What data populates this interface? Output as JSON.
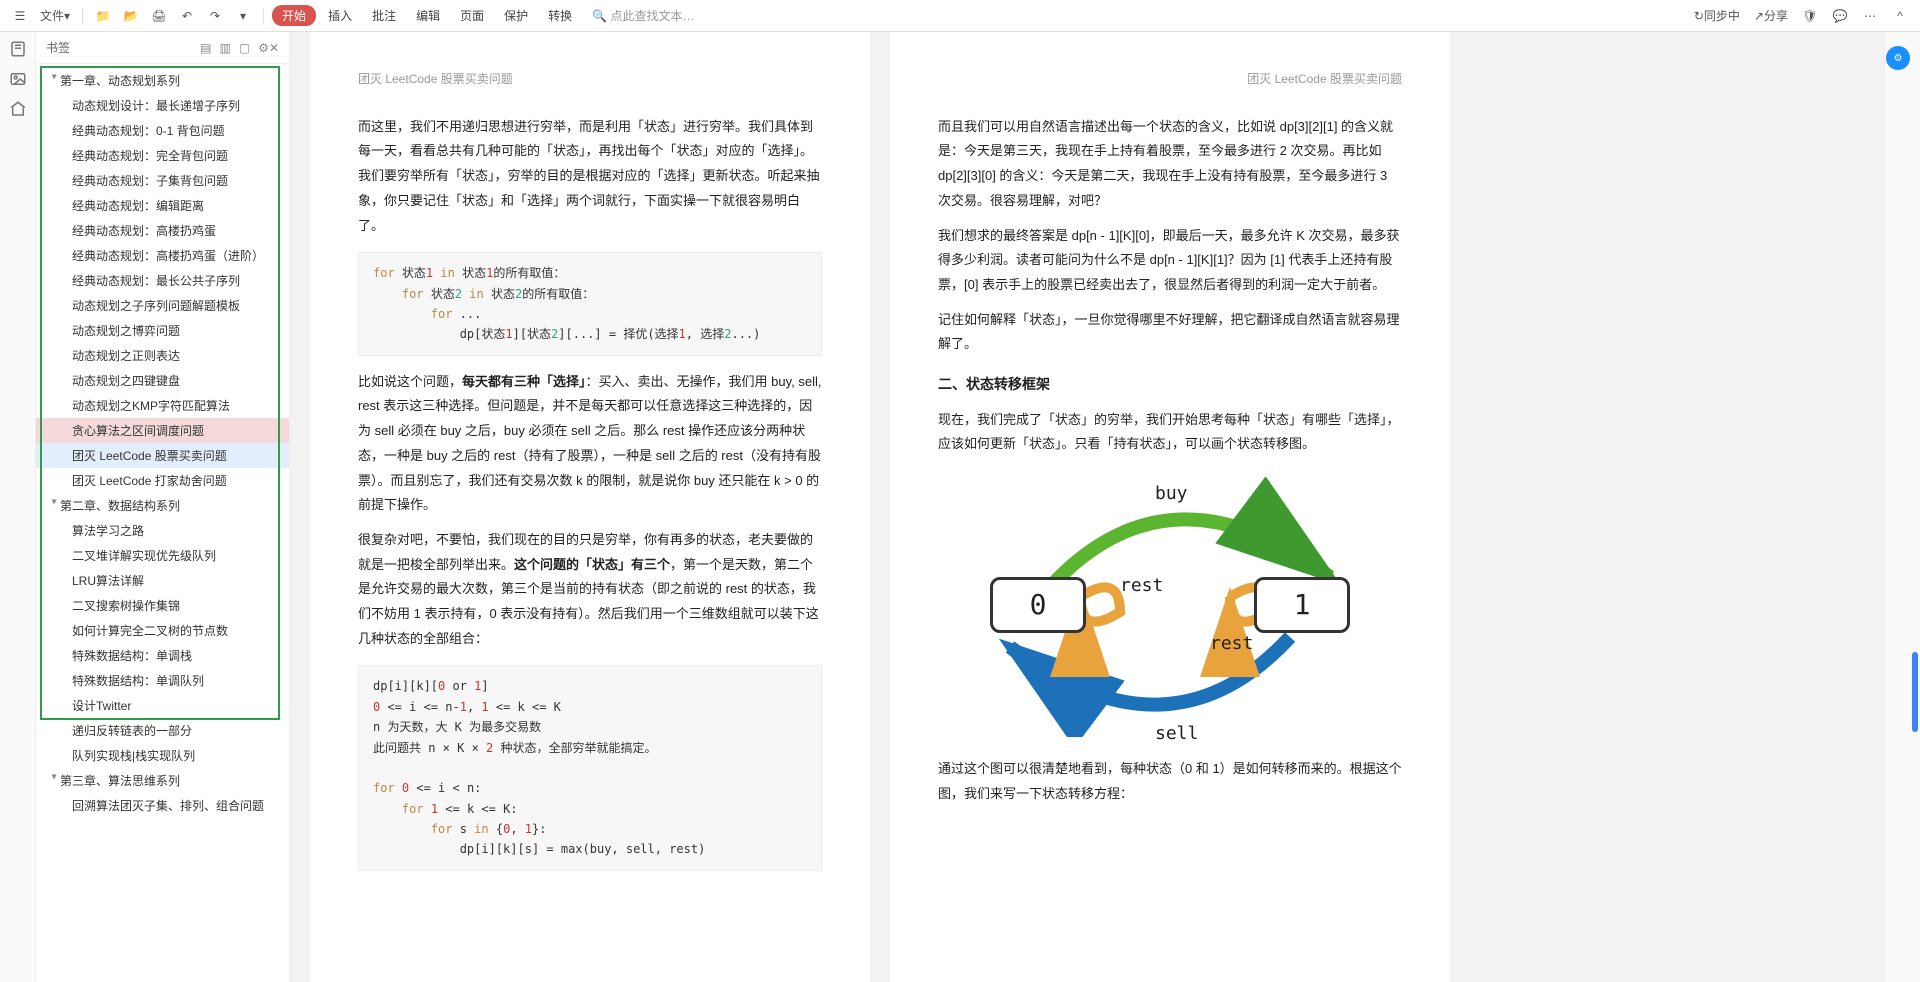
{
  "titlebar": {
    "file_menu": "文件",
    "start": "开始",
    "tabs": [
      "插入",
      "批注",
      "编辑",
      "页面",
      "保护",
      "转换"
    ],
    "search_placeholder": "点此查找文本…",
    "sync": "同步中",
    "share": "分享"
  },
  "sidebar": {
    "title": "书签",
    "chapters": [
      {
        "label": "第一章、动态规划系列",
        "items": [
          "动态规划设计：最长递增子序列",
          "经典动态规划：0-1 背包问题",
          "经典动态规划：完全背包问题",
          "经典动态规划：子集背包问题",
          "经典动态规划：编辑距离",
          "经典动态规划：高楼扔鸡蛋",
          "经典动态规划：高楼扔鸡蛋（进阶）",
          "经典动态规划：最长公共子序列",
          "动态规划之子序列问题解题模板",
          "动态规划之博弈问题",
          "动态规划之正则表达",
          "动态规划之四键键盘",
          "动态规划之KMP字符匹配算法",
          "贪心算法之区间调度问题",
          "团灭 LeetCode 股票买卖问题",
          "团灭 LeetCode 打家劫舍问题"
        ],
        "highlight_idx": 13,
        "selected_idx": 14
      },
      {
        "label": "第二章、数据结构系列",
        "items": [
          "算法学习之路",
          "二叉堆详解实现优先级队列",
          "LRU算法详解",
          "二叉搜索树操作集锦",
          "如何计算完全二叉树的节点数",
          "特殊数据结构：单调栈",
          "特殊数据结构：单调队列",
          "设计Twitter",
          "递归反转链表的一部分",
          "队列实现栈|栈实现队列"
        ]
      },
      {
        "label": "第三章、算法思维系列",
        "items": [
          "回溯算法团灭子集、排列、组合问题"
        ]
      }
    ]
  },
  "doc": {
    "header": "团灭 LeetCode 股票买卖问题",
    "left": {
      "p1": "而这里，我们不用递归思想进行穷举，而是利用「状态」进行穷举。我们具体到每一天，看看总共有几种可能的「状态」，再找出每个「状态」对应的「选择」。我们要穷举所有「状态」，穷举的目的是根据对应的「选择」更新状态。听起来抽象，你只要记住「状态」和「选择」两个词就行，下面实操一下就很容易明白了。",
      "code1_l1": "for 状态1 in 状态1的所有取值：",
      "code1_l2": "    for 状态2 in 状态2的所有取值：",
      "code1_l3": "        for ...",
      "code1_l4": "            dp[状态1][状态2][...] = 择优(选择1, 选择2...)",
      "p2a": "比如说这个问题，",
      "p2b": "每天都有三种「选择」",
      "p2c": "：买入、卖出、无操作，我们用 buy, sell, rest 表示这三种选择。但问题是，并不是每天都可以任意选择这三种选择的，因为 sell 必须在 buy 之后，buy 必须在 sell 之后。那么 rest 操作还应该分两种状态，一种是 buy 之后的 rest（持有了股票），一种是 sell 之后的 rest（没有持有股票）。而且别忘了，我们还有交易次数 k 的限制，就是说你 buy 还只能在 k > 0 的前提下操作。",
      "p3a": "很复杂对吧，不要怕，我们现在的目的只是穷举，你有再多的状态，老夫要做的就是一把梭全部列举出来。",
      "p3b": "这个问题的「状态」有三个",
      "p3c": "，第一个是天数，第二个是允许交易的最大次数，第三个是当前的持有状态（即之前说的 rest 的状态，我们不妨用 1 表示持有，0 表示没有持有）。然后我们用一个三维数组就可以装下这几种状态的全部组合：",
      "code2_l1": "dp[i][k][0 or 1]",
      "code2_l2": "0 <= i <= n-1, 1 <= k <= K",
      "code2_l3": "n 为天数，大 K 为最多交易数",
      "code2_l4": "此问题共 n × K × 2 种状态，全部穷举就能搞定。",
      "code2_l5": "",
      "code2_l6": "for 0 <= i < n:",
      "code2_l7": "    for 1 <= k <= K:",
      "code2_l8": "        for s in {0, 1}:",
      "code2_l9": "            dp[i][k][s] = max(buy, sell, rest)"
    },
    "right": {
      "p1": "而且我们可以用自然语言描述出每一个状态的含义，比如说 dp[3][2][1] 的含义就是：今天是第三天，我现在手上持有着股票，至今最多进行 2 次交易。再比如 dp[2][3][0] 的含义：今天是第二天，我现在手上没有持有股票，至今最多进行 3 次交易。很容易理解，对吧？",
      "p2": "我们想求的最终答案是 dp[n - 1][K][0]，即最后一天，最多允许 K 次交易，最多获得多少利润。读者可能问为什么不是 dp[n - 1][K][1]？因为 [1] 代表手上还持有股票，[0] 表示手上的股票已经卖出去了，很显然后者得到的利润一定大于前者。",
      "p3": "记住如何解释「状态」，一旦你觉得哪里不好理解，把它翻译成自然语言就容易理解了。",
      "h2": "二、状态转移框架",
      "p4": "现在，我们完成了「状态」的穷举，我们开始思考每种「状态」有哪些「选择」，应该如何更新「状态」。只看「持有状态」，可以画个状态转移图。",
      "diagram": {
        "s0": "0",
        "s1": "1",
        "buy": "buy",
        "sell": "sell",
        "rest": "rest"
      },
      "p5": "通过这个图可以很清楚地看到，每种状态（0 和 1）是如何转移而来的。根据这个图，我们来写一下状态转移方程："
    }
  }
}
